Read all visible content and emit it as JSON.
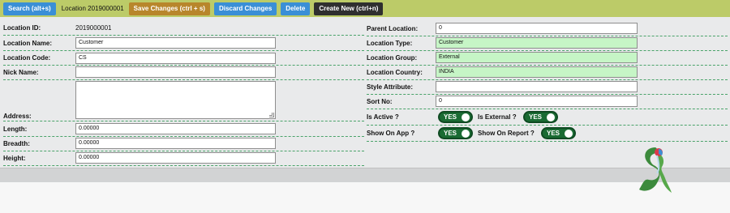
{
  "toolbar": {
    "search_label": "Search (alt+s)",
    "location_text": "Location 2019000001",
    "save_label": "Save Changes (ctrl + s)",
    "discard_label": "Discard Changes",
    "delete_label": "Delete",
    "create_label": "Create New (ctrl+n)"
  },
  "left": {
    "location_id_label": "Location ID:",
    "location_id_value": "2019000001",
    "location_name_label": "Location Name:",
    "location_name_value": "Customer",
    "location_code_label": "Location Code:",
    "location_code_value": "CS",
    "nick_name_label": "Nick Name:",
    "nick_name_value": "",
    "address_label": "Address:",
    "address_value": "",
    "length_label": "Length:",
    "length_value": "0.00000",
    "breadth_label": "Breadth:",
    "breadth_value": "0.00000",
    "height_label": "Height:",
    "height_value": "0.00000"
  },
  "right": {
    "parent_location_label": "Parent Location:",
    "parent_location_value": "0",
    "location_type_label": "Location Type:",
    "location_type_value": "Customer",
    "location_group_label": "Location Group:",
    "location_group_value": "External",
    "location_country_label": "Location Country:",
    "location_country_value": "INDIA",
    "style_attribute_label": "Style Attribute:",
    "style_attribute_value": "",
    "sort_no_label": "Sort No:",
    "sort_no_value": "0",
    "is_active_label": "Is Active ?",
    "is_active_value": "YES",
    "is_external_label": "Is External ?",
    "is_external_value": "YES",
    "show_on_app_label": "Show On App ?",
    "show_on_app_value": "YES",
    "show_on_report_label": "Show On Report ?",
    "show_on_report_value": "YES"
  },
  "colors": {
    "toolbar_bg": "#bccb68",
    "blue_button": "#3a8fd6",
    "orange_button": "#b8862b",
    "dark_button": "#2f2f2f",
    "green_field": "#c6f5c6",
    "toggle_green": "#1a6b33"
  },
  "icons": {
    "logo": "brand-logo-icon"
  }
}
